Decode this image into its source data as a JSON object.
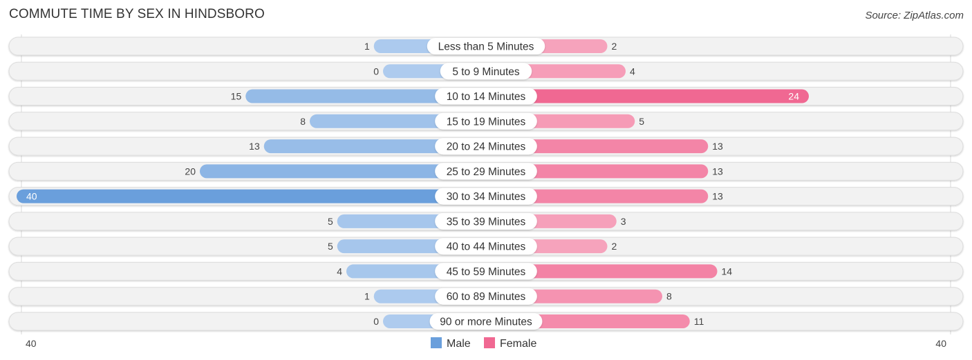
{
  "header": {
    "title": "COMMUTE TIME BY SEX IN HINDSBORO",
    "source": "Source: ZipAtlas.com"
  },
  "colors": {
    "male": "#6a9fdc",
    "male_light": "#aecbee",
    "female": "#f06892",
    "female_light": "#f7a8c0",
    "track": "#f2f2f2"
  },
  "chart_data": {
    "type": "bar",
    "orientation": "horizontal-diverging",
    "title": "COMMUTE TIME BY SEX IN HINDSBORO",
    "categories": [
      "Less than 5 Minutes",
      "5 to 9 Minutes",
      "10 to 14 Minutes",
      "15 to 19 Minutes",
      "20 to 24 Minutes",
      "25 to 29 Minutes",
      "30 to 34 Minutes",
      "35 to 39 Minutes",
      "40 to 44 Minutes",
      "45 to 59 Minutes",
      "60 to 89 Minutes",
      "90 or more Minutes"
    ],
    "series": [
      {
        "name": "Male",
        "values": [
          1,
          0,
          15,
          8,
          13,
          20,
          40,
          5,
          5,
          4,
          1,
          0
        ]
      },
      {
        "name": "Female",
        "values": [
          2,
          4,
          24,
          5,
          13,
          13,
          13,
          3,
          2,
          14,
          8,
          11
        ]
      }
    ],
    "axis": {
      "left_max_label": "40",
      "right_max_label": "40",
      "range": [
        0,
        40
      ]
    },
    "legend": {
      "position": "bottom-center",
      "entries": [
        "Male",
        "Female"
      ]
    }
  }
}
